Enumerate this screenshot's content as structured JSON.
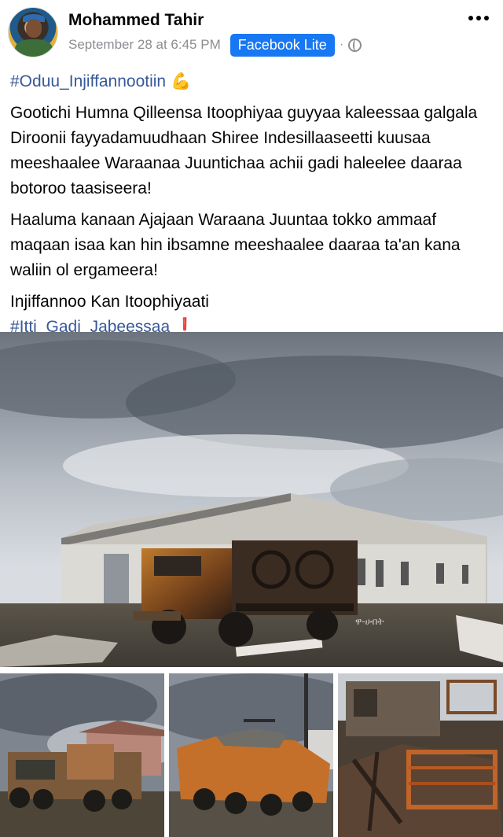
{
  "post": {
    "author": "Mohammed Tahir",
    "timestamp": "September 28 at 6:45 PM",
    "app_badge": "Facebook Lite",
    "separator": "·",
    "icons": {
      "avatar": "profile-photo",
      "privacy": "globe-icon",
      "more": "more-options-icon"
    }
  },
  "content": {
    "hashtag_1": "#Oduu_Injiffannootiin",
    "emoji_1": "💪",
    "paragraph_1": "Gootichi Humna Qilleensa Itoophiyaa guyyaa kaleessaa galgala Diroonii fayyadamuudhaan Shiree Indesillaaseetti kuusaa meeshaalee Waraanaa Juuntichaa achii gadi haleelee daaraa botoroo taasiseera!",
    "paragraph_2": "Haaluma kanaan Ajajaan Waraana Juuntaa tokko ammaaf maqaan isaa kan hin ibsamne meeshaalee daaraa ta'an kana waliin ol ergameera!",
    "paragraph_3": "Injiffannoo Kan Itoophiyaati",
    "hashtag_2": "#Itti_Gadi_Jabeessaa",
    "emoji_2": "❗"
  },
  "photos": {
    "watermark": "ዋ-ሀብት",
    "colors": {
      "link": "#385898",
      "badge": "#1877f2",
      "muted": "#8a8d91"
    }
  }
}
